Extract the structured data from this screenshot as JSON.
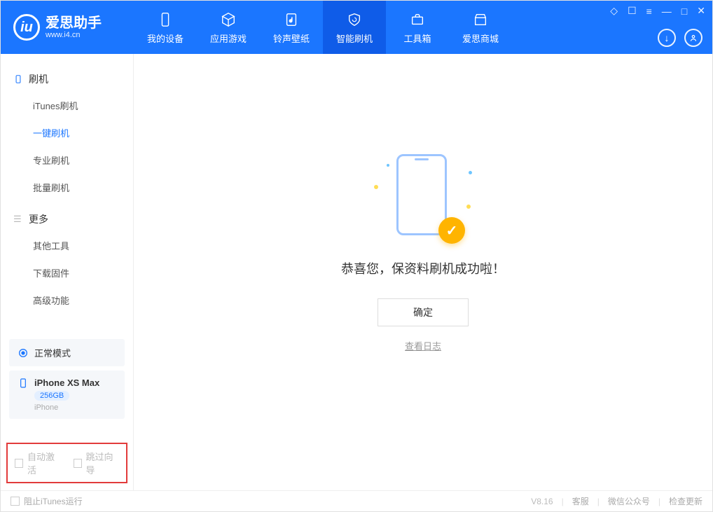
{
  "header": {
    "brand_title": "爱思助手",
    "brand_sub": "www.i4.cn",
    "tabs": [
      {
        "label": "我的设备"
      },
      {
        "label": "应用游戏"
      },
      {
        "label": "铃声壁纸"
      },
      {
        "label": "智能刷机"
      },
      {
        "label": "工具箱"
      },
      {
        "label": "爱思商城"
      }
    ]
  },
  "sidebar": {
    "group1_title": "刷机",
    "group1_items": [
      "iTunes刷机",
      "一键刷机",
      "专业刷机",
      "批量刷机"
    ],
    "group2_title": "更多",
    "group2_items": [
      "其他工具",
      "下载固件",
      "高级功能"
    ]
  },
  "device": {
    "mode_label": "正常模式",
    "name": "iPhone XS Max",
    "capacity": "256GB",
    "type": "iPhone"
  },
  "options": {
    "auto_activate": "自动激活",
    "skip_guide": "跳过向导"
  },
  "main": {
    "message": "恭喜您，保资料刷机成功啦！",
    "ok_label": "确定",
    "log_link": "查看日志"
  },
  "footer": {
    "block_itunes": "阻止iTunes运行",
    "version": "V8.16",
    "links": [
      "客服",
      "微信公众号",
      "检查更新"
    ]
  }
}
